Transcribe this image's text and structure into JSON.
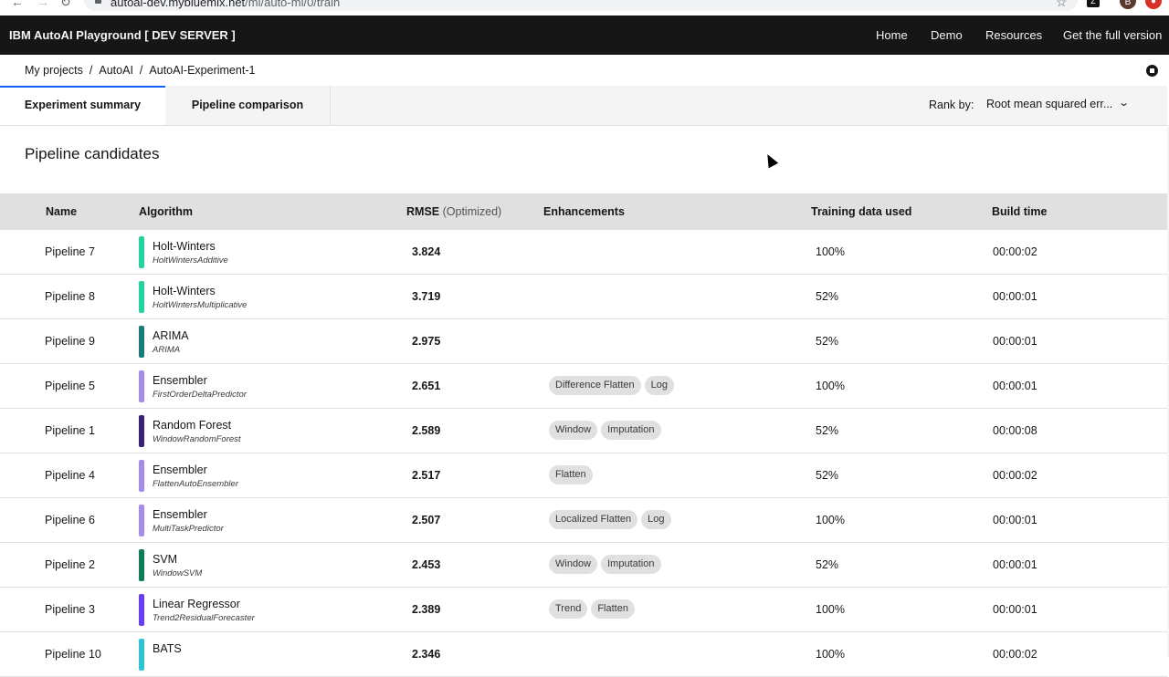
{
  "browser": {
    "url_host": "autoai-dev.mybluemix.net",
    "url_path": "/ml/auto-ml/0/train"
  },
  "header": {
    "brand": "IBM AutoAI Playground [ DEV SERVER ]",
    "nav": [
      "Home",
      "Demo",
      "Resources",
      "Get the full version"
    ]
  },
  "breadcrumb": [
    "My projects",
    "AutoAI",
    "AutoAI-Experiment-1"
  ],
  "tabs": {
    "active": "Experiment summary",
    "inactive": "Pipeline comparison"
  },
  "rank": {
    "label": "Rank by:",
    "value": "Root mean squared err..."
  },
  "section_title": "Pipeline candidates",
  "table": {
    "headers": {
      "name": "Name",
      "algorithm": "Algorithm",
      "rmse": "RMSE",
      "rmse_suffix": "(Optimized)",
      "enhancements": "Enhancements",
      "training": "Training data used",
      "build": "Build time"
    },
    "rows": [
      {
        "name": "Pipeline 7",
        "algo": "Holt-Winters",
        "algo_sub": "HoltWintersAdditive",
        "color": "#24d39f",
        "rmse": "3.824",
        "tags": [],
        "training": "100%",
        "build": "00:00:02"
      },
      {
        "name": "Pipeline 8",
        "algo": "Holt-Winters",
        "algo_sub": "HoltWintersMultiplicative",
        "color": "#24d39f",
        "rmse": "3.719",
        "tags": [],
        "training": "52%",
        "build": "00:00:01"
      },
      {
        "name": "Pipeline 9",
        "algo": "ARIMA",
        "algo_sub": "ARIMA",
        "color": "#1b7a7a",
        "rmse": "2.975",
        "tags": [],
        "training": "52%",
        "build": "00:00:01"
      },
      {
        "name": "Pipeline 5",
        "algo": "Ensembler",
        "algo_sub": "FirstOrderDeltaPredictor",
        "color": "#a78bea",
        "rmse": "2.651",
        "tags": [
          "Difference Flatten",
          "Log"
        ],
        "training": "100%",
        "build": "00:00:01"
      },
      {
        "name": "Pipeline 1",
        "algo": "Random Forest",
        "algo_sub": "WindowRandomForest",
        "color": "#3b1f7a",
        "rmse": "2.589",
        "tags": [
          "Window",
          "Imputation"
        ],
        "training": "52%",
        "build": "00:00:08"
      },
      {
        "name": "Pipeline 4",
        "algo": "Ensembler",
        "algo_sub": "FlattenAutoEnsembler",
        "color": "#a78bea",
        "rmse": "2.517",
        "tags": [
          "Flatten"
        ],
        "training": "52%",
        "build": "00:00:02"
      },
      {
        "name": "Pipeline 6",
        "algo": "Ensembler",
        "algo_sub": "MultiTaskPredictor",
        "color": "#a78bea",
        "rmse": "2.507",
        "tags": [
          "Localized Flatten",
          "Log"
        ],
        "training": "100%",
        "build": "00:00:01"
      },
      {
        "name": "Pipeline 2",
        "algo": "SVM",
        "algo_sub": "WindowSVM",
        "color": "#117a5a",
        "rmse": "2.453",
        "tags": [
          "Window",
          "Imputation"
        ],
        "training": "52%",
        "build": "00:00:01"
      },
      {
        "name": "Pipeline 3",
        "algo": "Linear Regressor",
        "algo_sub": "Trend2ResidualForecaster",
        "color": "#6a3df0",
        "rmse": "2.389",
        "tags": [
          "Trend",
          "Flatten"
        ],
        "training": "100%",
        "build": "00:00:01"
      },
      {
        "name": "Pipeline 10",
        "algo": "BATS",
        "algo_sub": "",
        "color": "#2ec4d6",
        "rmse": "2.346",
        "tags": [],
        "training": "100%",
        "build": "00:00:02"
      }
    ]
  }
}
